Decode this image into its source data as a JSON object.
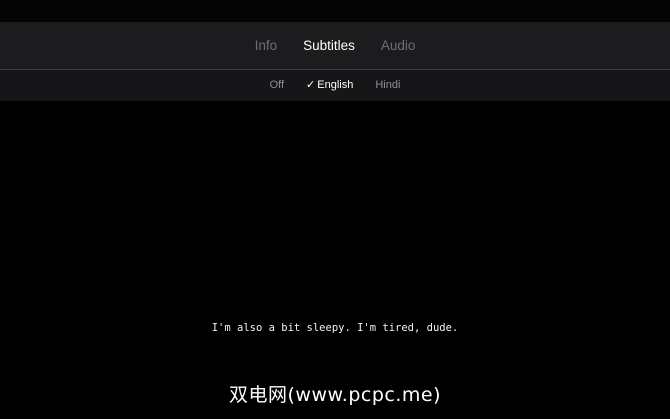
{
  "tabs": [
    {
      "label": "Info",
      "active": false
    },
    {
      "label": "Subtitles",
      "active": true
    },
    {
      "label": "Audio",
      "active": false
    }
  ],
  "subtitle_options": [
    {
      "label": "Off",
      "selected": false
    },
    {
      "label": "English",
      "selected": true
    },
    {
      "label": "Hindi",
      "selected": false
    }
  ],
  "check_glyph": "✓",
  "video": {
    "subtitle_text": "I'm also a bit sleepy. I'm tired, dude.",
    "watermark_text": "双电网(www.pcpc.me)"
  },
  "colors": {
    "panel": "#1c1c1e",
    "option_bar": "#161618",
    "active_text": "#ffffff",
    "inactive_text": "#6e6e73"
  }
}
